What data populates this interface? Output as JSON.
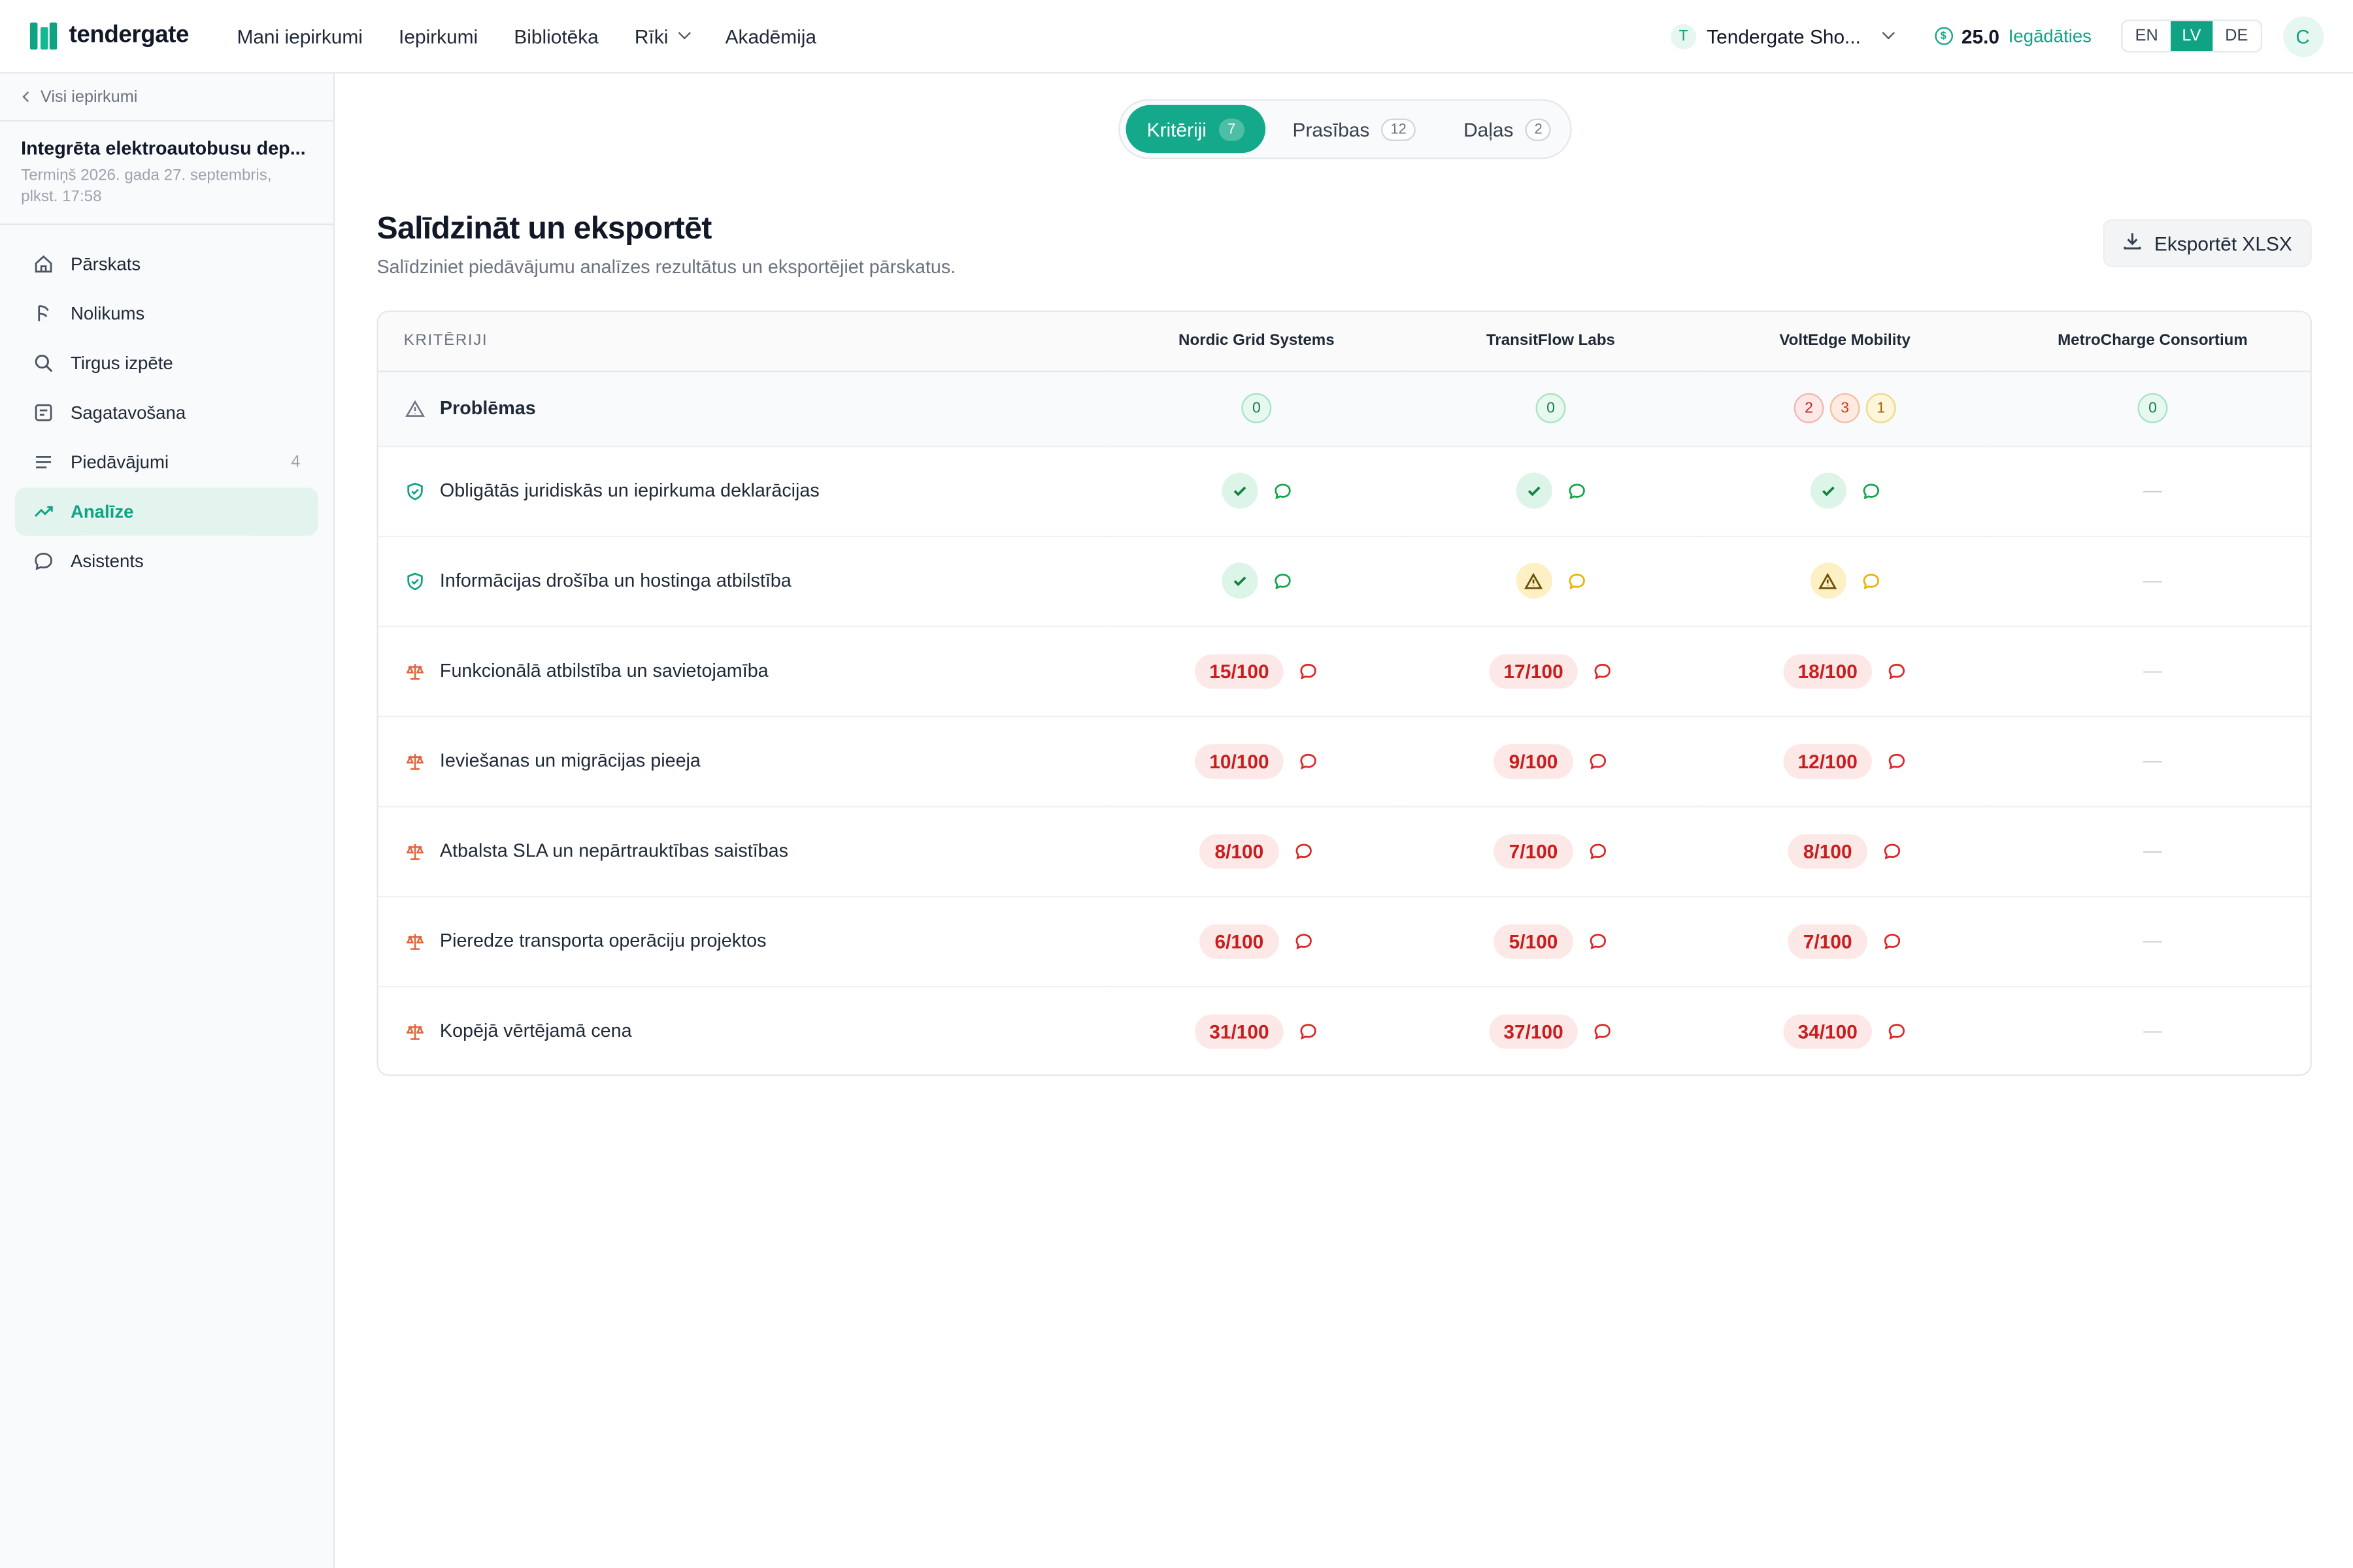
{
  "brand": {
    "name": "tendergate"
  },
  "nav": {
    "items": [
      "Mani iepirkumi",
      "Iepirkumi",
      "Bibliotēka",
      "Rīki",
      "Akadēmija"
    ]
  },
  "org": {
    "initial": "T",
    "name": "Tendergate Sho..."
  },
  "credits": {
    "amount": "25.0",
    "topup": "Iegādāties"
  },
  "languages": {
    "items": [
      "EN",
      "LV",
      "DE"
    ],
    "active": "LV"
  },
  "user": {
    "initial": "C"
  },
  "sidebar": {
    "back": "Visi iepirkumi",
    "project_title": "Integrēta elektroautobusu dep...",
    "deadline": "Termiņš 2026. gada 27. septembris, plkst. 17:58",
    "items": [
      {
        "label": "Pārskats",
        "icon": "home-icon"
      },
      {
        "label": "Nolikums",
        "icon": "document-icon"
      },
      {
        "label": "Tirgus izpēte",
        "icon": "search-icon"
      },
      {
        "label": "Sagatavošana",
        "icon": "form-icon"
      },
      {
        "label": "Piedāvājumi",
        "icon": "list-icon",
        "count": "4"
      },
      {
        "label": "Analīze",
        "icon": "trend-icon",
        "active": true
      },
      {
        "label": "Asistents",
        "icon": "chat-icon"
      }
    ]
  },
  "tabs": [
    {
      "label": "Kritēriji",
      "count": "7",
      "active": true
    },
    {
      "label": "Prasības",
      "count": "12"
    },
    {
      "label": "Daļas",
      "count": "2"
    }
  ],
  "page": {
    "title": "Salīdzināt un eksportēt",
    "subtitle": "Salīdziniet piedāvājumu analīzes rezultātus un eksportējiet pārskatus.",
    "export_label": "Eksportēt XLSX"
  },
  "table": {
    "criteria_header": "KRITĒRIJI",
    "vendors": [
      "Nordic Grid Systems",
      "TransitFlow Labs",
      "VoltEdge Mobility",
      "MetroCharge Consortium"
    ],
    "problems": {
      "label": "Problēmas",
      "counts": [
        [
          {
            "v": "0",
            "tone": "green"
          }
        ],
        [
          {
            "v": "0",
            "tone": "green"
          }
        ],
        [
          {
            "v": "2",
            "tone": "red"
          },
          {
            "v": "3",
            "tone": "orange"
          },
          {
            "v": "1",
            "tone": "yellow"
          }
        ],
        [
          {
            "v": "0",
            "tone": "green"
          }
        ]
      ]
    },
    "rows": [
      {
        "name": "Obligātās juridiskās un iepirkuma deklarācijas",
        "kind": "shield",
        "cells": [
          {
            "type": "ok"
          },
          {
            "type": "ok"
          },
          {
            "type": "ok"
          },
          {
            "type": "none",
            "text": "—"
          }
        ]
      },
      {
        "name": "Informācijas drošība un hostinga atbilstība",
        "kind": "shield",
        "cells": [
          {
            "type": "ok"
          },
          {
            "type": "warn"
          },
          {
            "type": "warn"
          },
          {
            "type": "none",
            "text": "—"
          }
        ]
      },
      {
        "name": "Funkcionālā atbilstība un savietojamība",
        "kind": "scale",
        "cells": [
          {
            "type": "score",
            "text": "15/100"
          },
          {
            "type": "score",
            "text": "17/100"
          },
          {
            "type": "score",
            "text": "18/100"
          },
          {
            "type": "none",
            "text": "—"
          }
        ]
      },
      {
        "name": "Ieviešanas un migrācijas pieeja",
        "kind": "scale",
        "cells": [
          {
            "type": "score",
            "text": "10/100"
          },
          {
            "type": "score",
            "text": "9/100"
          },
          {
            "type": "score",
            "text": "12/100"
          },
          {
            "type": "none",
            "text": "—"
          }
        ]
      },
      {
        "name": "Atbalsta SLA un nepārtrauktības saistības",
        "kind": "scale",
        "cells": [
          {
            "type": "score",
            "text": "8/100"
          },
          {
            "type": "score",
            "text": "7/100"
          },
          {
            "type": "score",
            "text": "8/100"
          },
          {
            "type": "none",
            "text": "—"
          }
        ]
      },
      {
        "name": "Pieredze transporta operāciju projektos",
        "kind": "scale",
        "cells": [
          {
            "type": "score",
            "text": "6/100"
          },
          {
            "type": "score",
            "text": "5/100"
          },
          {
            "type": "score",
            "text": "7/100"
          },
          {
            "type": "none",
            "text": "—"
          }
        ]
      },
      {
        "name": "Kopējā vērtējamā cena",
        "kind": "scale",
        "cells": [
          {
            "type": "score",
            "text": "31/100"
          },
          {
            "type": "score",
            "text": "37/100"
          },
          {
            "type": "score",
            "text": "34/100"
          },
          {
            "type": "none",
            "text": "—"
          }
        ]
      }
    ]
  },
  "colors": {
    "accent": "#0fa383",
    "score_bg": "#fde8e8",
    "score_text": "#c81e1e",
    "ok_bg": "#ddf4e8",
    "warn_bg": "#fcf0c4"
  }
}
